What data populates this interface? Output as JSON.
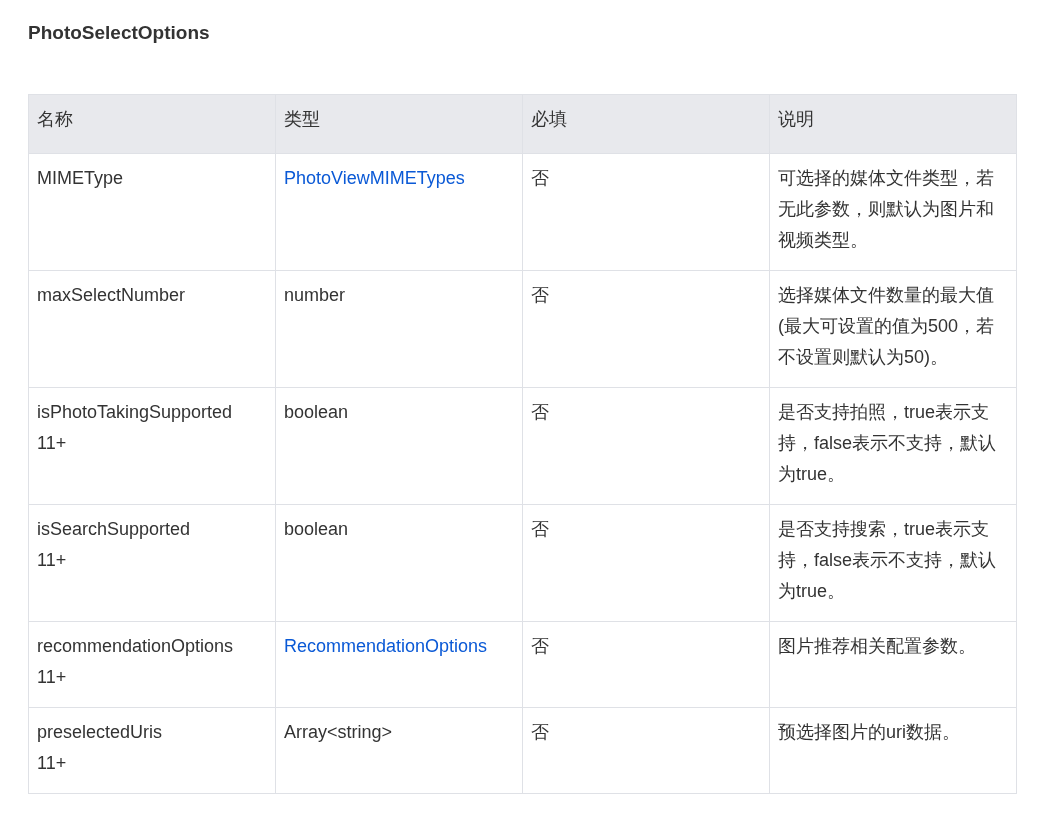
{
  "title": "PhotoSelectOptions",
  "table": {
    "columns": [
      "名称",
      "类型",
      "必填",
      "说明"
    ],
    "rows": [
      {
        "name": "MIMEType",
        "type": {
          "text": "PhotoViewMIMETypes",
          "kind": "link"
        },
        "required": "否",
        "description": "可选择的媒体文件类型，若无此参数，则默认为图片和视频类型。"
      },
      {
        "name": "maxSelectNumber",
        "type": {
          "text": "number",
          "kind": "plain"
        },
        "required": "否",
        "description": "选择媒体文件数量的最大值(最大可设置的值为500，若不设置则默认为50)。"
      },
      {
        "name": "isPhotoTakingSupported",
        "version": "11+",
        "type": {
          "text": "boolean",
          "kind": "plain"
        },
        "required": "否",
        "description": "是否支持拍照，true表示支持，false表示不支持，默认为true。"
      },
      {
        "name": "isSearchSupported",
        "version": "11+",
        "type": {
          "text": "boolean",
          "kind": "plain"
        },
        "required": "否",
        "description": "是否支持搜索，true表示支持，false表示不支持，默认为true。"
      },
      {
        "name": "recommendationOptions",
        "version": "11+",
        "type": {
          "text": "RecommendationOptions",
          "kind": "link"
        },
        "required": "否",
        "description": "图片推荐相关配置参数。"
      },
      {
        "name": "preselectedUris",
        "version": "11+",
        "type": {
          "text": "Array<string>",
          "kind": "plain"
        },
        "required": "否",
        "description": "预选择图片的uri数据。"
      }
    ]
  }
}
